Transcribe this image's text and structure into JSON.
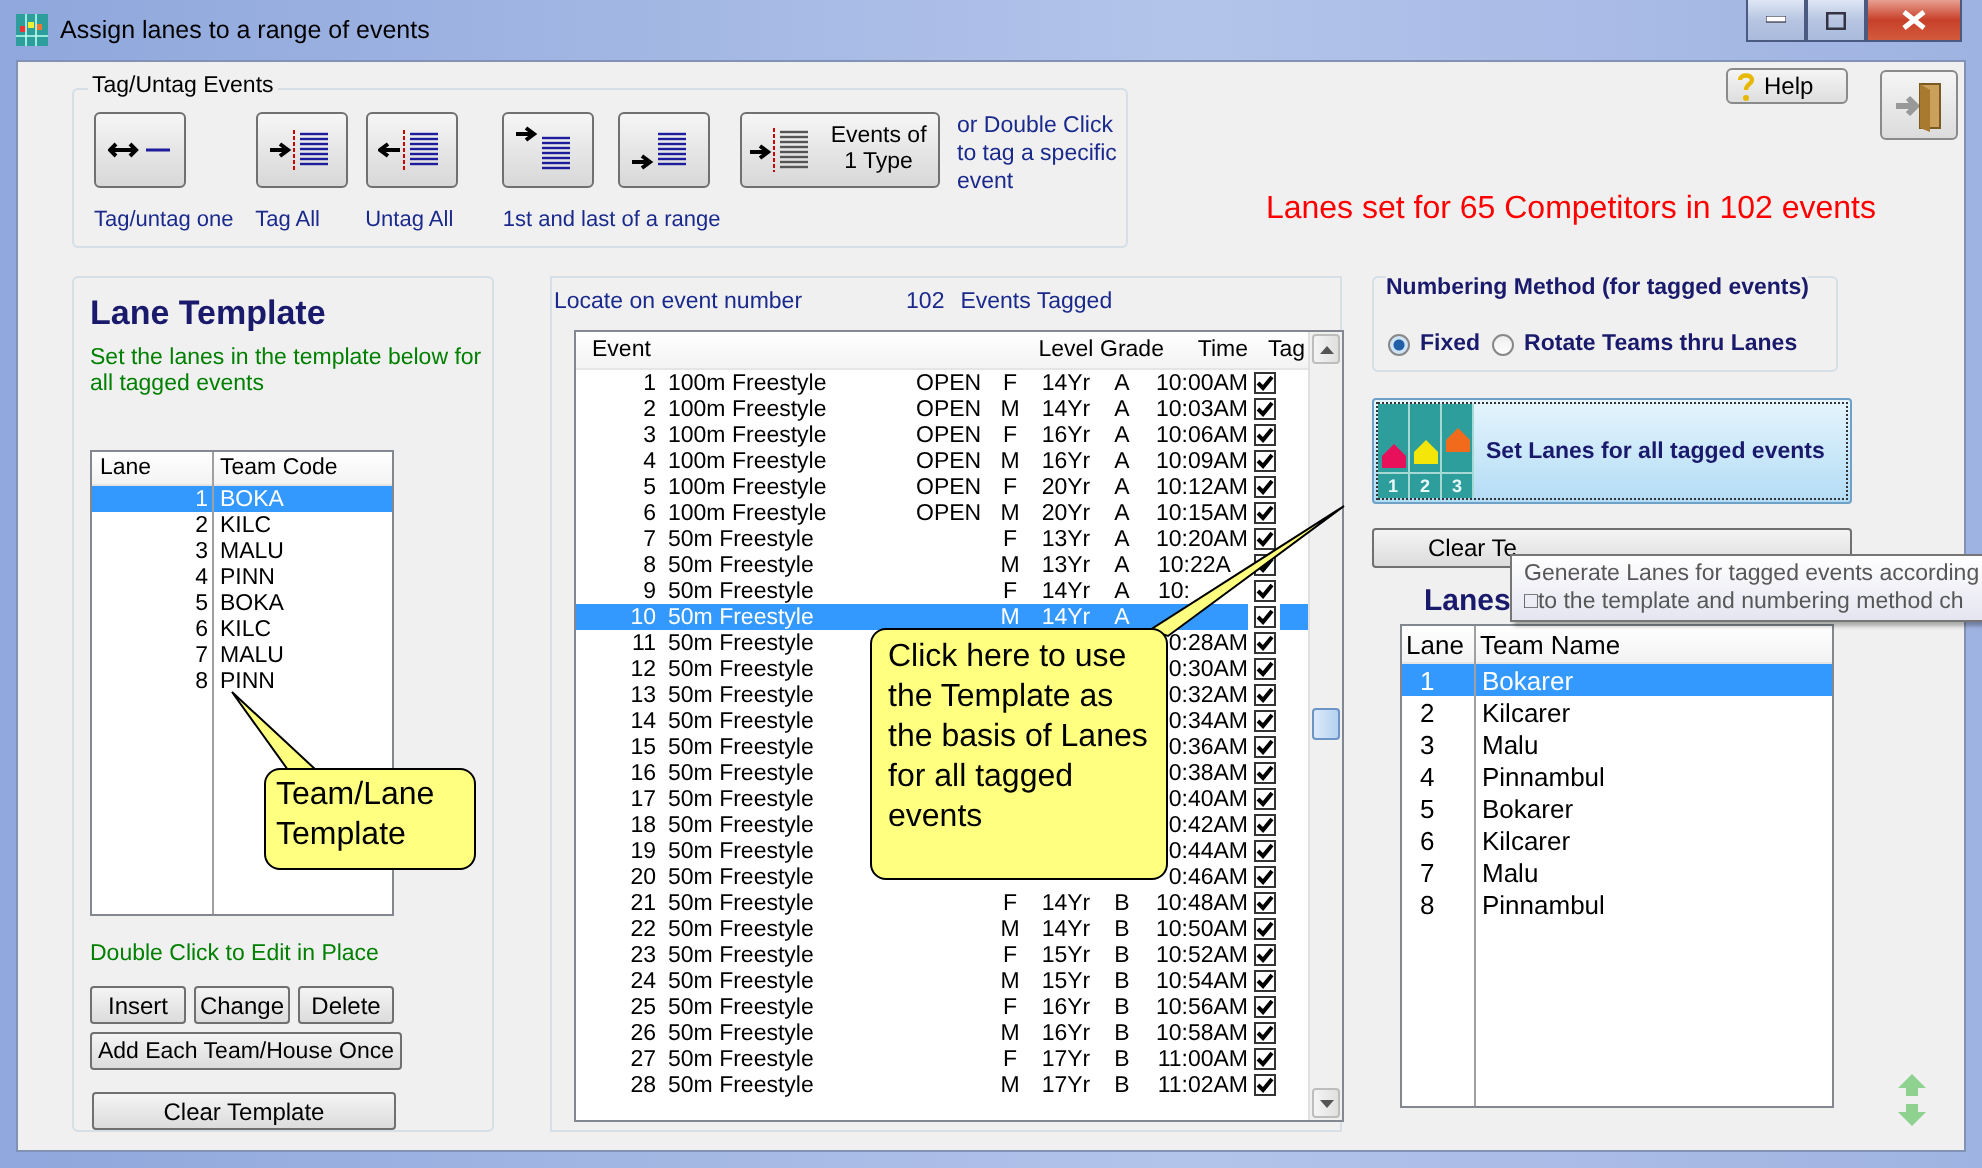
{
  "window": {
    "title": "Assign lanes to a range of events"
  },
  "tag_group": {
    "title": "Tag/Untag Events",
    "tools": [
      {
        "kind": "one",
        "caption": "Tag/untag one"
      },
      {
        "kind": "all",
        "caption": "Tag All"
      },
      {
        "kind": "none",
        "caption": "Untag All"
      },
      {
        "kind": "first"
      },
      {
        "kind": "last"
      },
      {
        "kind": "type",
        "label": "Events of 1 Type"
      }
    ],
    "range_caption": "1st and last of a range",
    "hint": "or Double Click to tag a specific event"
  },
  "help_button": {
    "label": "Help"
  },
  "status": "Lanes set for 65 Competitors in 102 events",
  "template": {
    "title": "Lane Template",
    "instructions": "Set the lanes in the template below for all tagged events",
    "columns": [
      "Lane",
      "Team Code"
    ],
    "rows": [
      {
        "lane": "1",
        "code": "BOKA",
        "selected": true
      },
      {
        "lane": "2",
        "code": "KILC",
        "selected": false
      },
      {
        "lane": "3",
        "code": "MALU",
        "selected": false
      },
      {
        "lane": "4",
        "code": "PINN",
        "selected": false
      },
      {
        "lane": "5",
        "code": "BOKA",
        "selected": false
      },
      {
        "lane": "6",
        "code": "KILC",
        "selected": false
      },
      {
        "lane": "7",
        "code": "MALU",
        "selected": false
      },
      {
        "lane": "8",
        "code": "PINN",
        "selected": false
      }
    ],
    "hint": "Double Click to Edit in Place",
    "buttons": [
      "Insert",
      "Change",
      "Delete"
    ],
    "add_button": "Add Each Team/House Once",
    "clear_button": "Clear Template",
    "callout": "Team/Lane Template"
  },
  "events": {
    "locate_label": "Locate on event number",
    "tagged_count": "102",
    "tagged_label": "Events Tagged",
    "columns": [
      "Event",
      "Level",
      "Grade",
      "Time",
      "Tag"
    ],
    "rows": [
      {
        "number": "1",
        "name": "100m Freestyle",
        "division": "OPEN",
        "gender": "F",
        "level": "14Yr",
        "grade": "A",
        "time": "10:00AM",
        "tagged": true,
        "selected": false
      },
      {
        "number": "2",
        "name": "100m Freestyle",
        "division": "OPEN",
        "gender": "M",
        "level": "14Yr",
        "grade": "A",
        "time": "10:03AM",
        "tagged": true,
        "selected": false
      },
      {
        "number": "3",
        "name": "100m Freestyle",
        "division": "OPEN",
        "gender": "F",
        "level": "16Yr",
        "grade": "A",
        "time": "10:06AM",
        "tagged": true,
        "selected": false
      },
      {
        "number": "4",
        "name": "100m Freestyle",
        "division": "OPEN",
        "gender": "M",
        "level": "16Yr",
        "grade": "A",
        "time": "10:09AM",
        "tagged": true,
        "selected": false
      },
      {
        "number": "5",
        "name": "100m Freestyle",
        "division": "OPEN",
        "gender": "F",
        "level": "20Yr",
        "grade": "A",
        "time": "10:12AM",
        "tagged": true,
        "selected": false
      },
      {
        "number": "6",
        "name": "100m Freestyle",
        "division": "OPEN",
        "gender": "M",
        "level": "20Yr",
        "grade": "A",
        "time": "10:15AM",
        "tagged": true,
        "selected": false
      },
      {
        "number": "7",
        "name": "50m Freestyle",
        "gender": "F",
        "level": "13Yr",
        "grade": "A",
        "time": "10:20AM",
        "tagged": true,
        "selected": false
      },
      {
        "number": "8",
        "name": "50m Freestyle",
        "gender": "M",
        "level": "13Yr",
        "grade": "A",
        "time": "10:22A",
        "time_cut": true,
        "tagged": true,
        "selected": false
      },
      {
        "number": "9",
        "name": "50m Freestyle",
        "gender": "F",
        "level": "14Yr",
        "grade": "A",
        "time": "10:",
        "time_cut": true,
        "tagged": true,
        "selected": false
      },
      {
        "number": "10",
        "name": "50m Freestyle",
        "gender": "M",
        "level": "14Yr",
        "grade": "A",
        "tagged": true,
        "selected": true
      },
      {
        "number": "11",
        "name": "50m Freestyle",
        "time": "0:28AM",
        "tagged": true,
        "selected": false
      },
      {
        "number": "12",
        "name": "50m Freestyle",
        "time": "0:30AM",
        "tagged": true,
        "selected": false
      },
      {
        "number": "13",
        "name": "50m Freestyle",
        "time": "0:32AM",
        "tagged": true,
        "selected": false
      },
      {
        "number": "14",
        "name": "50m Freestyle",
        "time": "0:34AM",
        "tagged": true,
        "selected": false
      },
      {
        "number": "15",
        "name": "50m Freestyle",
        "time": "0:36AM",
        "tagged": true,
        "selected": false
      },
      {
        "number": "16",
        "name": "50m Freestyle",
        "time": "0:38AM",
        "tagged": true,
        "selected": false
      },
      {
        "number": "17",
        "name": "50m Freestyle",
        "time": "0:40AM",
        "tagged": true,
        "selected": false
      },
      {
        "number": "18",
        "name": "50m Freestyle",
        "time": "0:42AM",
        "tagged": true,
        "selected": false
      },
      {
        "number": "19",
        "name": "50m Freestyle",
        "time": "0:44AM",
        "tagged": true,
        "selected": false
      },
      {
        "number": "20",
        "name": "50m Freestyle",
        "time": "0:46AM",
        "tagged": true,
        "selected": false
      },
      {
        "number": "21",
        "name": "50m Freestyle",
        "gender": "F",
        "level": "14Yr",
        "grade": "B",
        "time": "10:48AM",
        "tagged": true,
        "selected": false
      },
      {
        "number": "22",
        "name": "50m Freestyle",
        "gender": "M",
        "level": "14Yr",
        "grade": "B",
        "time": "10:50AM",
        "tagged": true,
        "selected": false
      },
      {
        "number": "23",
        "name": "50m Freestyle",
        "gender": "F",
        "level": "15Yr",
        "grade": "B",
        "time": "10:52AM",
        "tagged": true,
        "selected": false
      },
      {
        "number": "24",
        "name": "50m Freestyle",
        "gender": "M",
        "level": "15Yr",
        "grade": "B",
        "time": "10:54AM",
        "tagged": true,
        "selected": false
      },
      {
        "number": "25",
        "name": "50m Freestyle",
        "gender": "F",
        "level": "16Yr",
        "grade": "B",
        "time": "10:56AM",
        "tagged": true,
        "selected": false
      },
      {
        "number": "26",
        "name": "50m Freestyle",
        "gender": "M",
        "level": "16Yr",
        "grade": "B",
        "time": "10:58AM",
        "tagged": true,
        "selected": false
      },
      {
        "number": "27",
        "name": "50m Freestyle",
        "gender": "F",
        "level": "17Yr",
        "grade": "B",
        "time": "11:00AM",
        "tagged": true,
        "selected": false
      },
      {
        "number": "28",
        "name": "50m Freestyle",
        "gender": "M",
        "level": "17Yr",
        "grade": "B",
        "time": "11:02AM",
        "tagged": true,
        "selected": false
      }
    ],
    "callout": "Click here to use the Template as the basis of Lanes for all tagged events"
  },
  "numbering": {
    "title": "Numbering Method (for tagged events)",
    "options": [
      {
        "label": "Fixed",
        "selected": true
      },
      {
        "label": "Rotate Teams thru Lanes",
        "selected": false
      }
    ]
  },
  "set_button": {
    "label": "Set Lanes for all tagged events",
    "lane_numbers": [
      "1",
      "2",
      "3"
    ]
  },
  "clear_button": "Clear Te",
  "lanes": {
    "heading": "Lanes",
    "columns": [
      "Lane",
      "Team Name"
    ],
    "rows": [
      {
        "lane": "1",
        "team": "Bokarer",
        "selected": true
      },
      {
        "lane": "2",
        "team": "Kilcarer",
        "selected": false
      },
      {
        "lane": "3",
        "team": "Malu",
        "selected": false
      },
      {
        "lane": "4",
        "team": "Pinnambul",
        "selected": false
      },
      {
        "lane": "5",
        "team": "Bokarer",
        "selected": false
      },
      {
        "lane": "6",
        "team": "Kilcarer",
        "selected": false
      },
      {
        "lane": "7",
        "team": "Malu",
        "selected": false
      },
      {
        "lane": "8",
        "team": "Pinnambul",
        "selected": false
      }
    ]
  },
  "tooltip": [
    "Generate Lanes for tagged events according",
    "□to the template and numbering method ch"
  ]
}
